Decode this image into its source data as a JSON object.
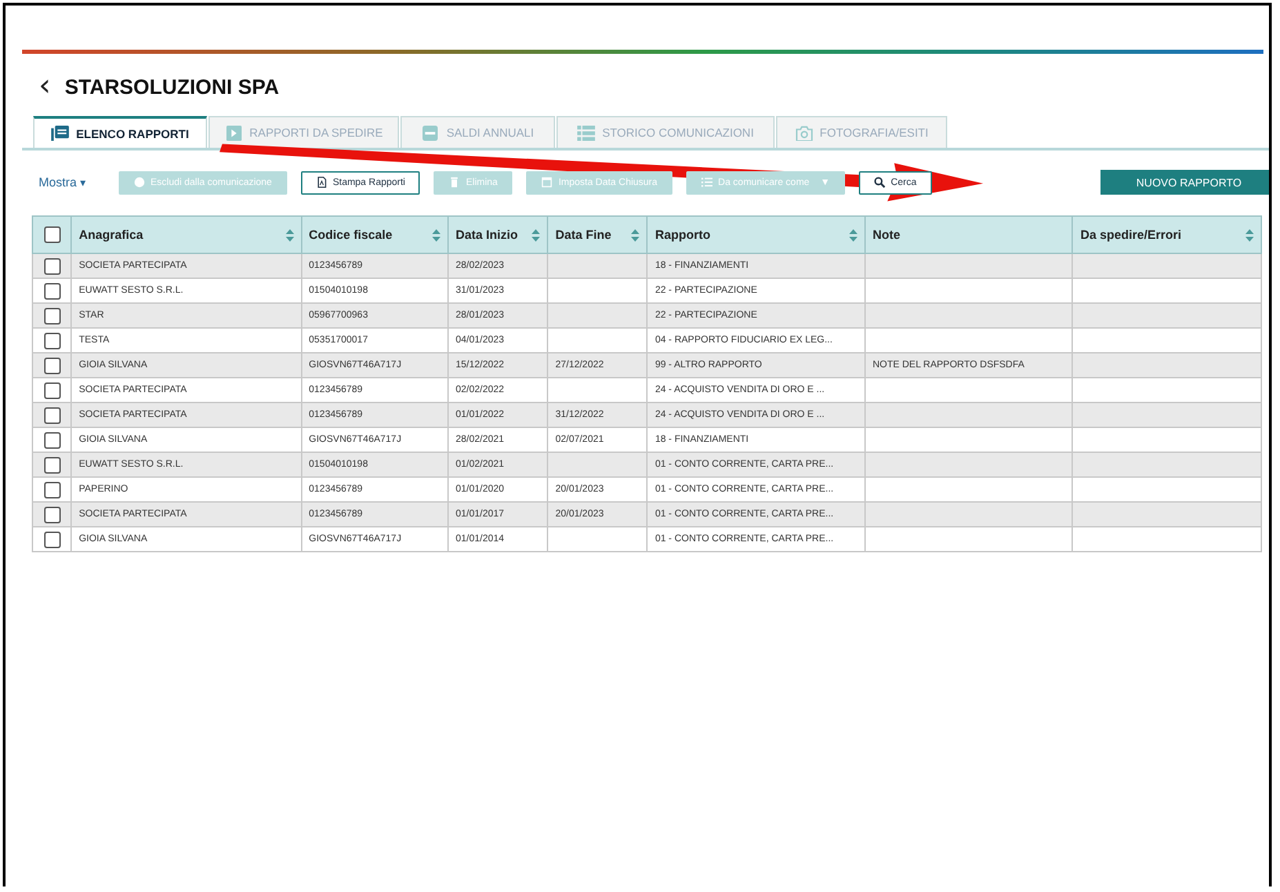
{
  "header": {
    "back": "‹",
    "title": "STARSOLUZIONI SPA"
  },
  "tabs": [
    {
      "label": "ELENCO RAPPORTI",
      "kind": "list",
      "selected": true
    },
    {
      "label": "RAPPORTI DA SPEDIRE",
      "kind": "send",
      "selected": false
    },
    {
      "label": "SALDI ANNUALI",
      "kind": "calendar",
      "selected": false
    },
    {
      "label": "STORICO COMUNICAZIONI",
      "kind": "rows",
      "selected": false
    },
    {
      "label": "FOTOGRAFIA/ESITI",
      "kind": "camera",
      "selected": false
    }
  ],
  "toolbar": {
    "show_menu": "Mostra",
    "show_menu_caret": "▾",
    "buttons": [
      {
        "label": "Escludi dalla comunicazione",
        "kind": "minus",
        "disabled": true
      },
      {
        "label": "Stampa Rapporti",
        "kind": "doc",
        "disabled": false
      },
      {
        "label": "Elimina",
        "kind": "trash",
        "disabled": true
      },
      {
        "label": "Imposta Data Chiusura",
        "kind": "calendar",
        "disabled": true
      },
      {
        "label": "Da comunicare come",
        "kind": "list",
        "disabled": true,
        "dropdown_caret": "▼"
      },
      {
        "label": "Cerca",
        "kind": "search",
        "disabled": false
      }
    ],
    "primary_button": "NUOVO RAPPORTO"
  },
  "table": {
    "select_all_checked": false,
    "columns": [
      {
        "label": "Anagrafica",
        "sortable": true
      },
      {
        "label": "Codice fiscale",
        "sortable": true
      },
      {
        "label": "Data Inizio",
        "sortable": true
      },
      {
        "label": "Data Fine",
        "sortable": true
      },
      {
        "label": "Rapporto",
        "sortable": true
      },
      {
        "label": "Note",
        "sortable": false
      },
      {
        "label": "Da spedire/Errori",
        "sortable": true
      }
    ],
    "rows": [
      {
        "checked": false,
        "cells": [
          "SOCIETA PARTECIPATA",
          "0123456789",
          "28/02/2023",
          "",
          "18 - FINANZIAMENTI",
          "",
          ""
        ]
      },
      {
        "checked": false,
        "cells": [
          "EUWATT SESTO S.R.L.",
          "01504010198",
          "31/01/2023",
          "",
          "22 - PARTECIPAZIONE",
          "",
          ""
        ]
      },
      {
        "checked": false,
        "cells": [
          "STAR",
          "05967700963",
          "28/01/2023",
          "",
          "22 - PARTECIPAZIONE",
          "",
          ""
        ]
      },
      {
        "checked": false,
        "cells": [
          "TESTA",
          "05351700017",
          "04/01/2023",
          "",
          "04 - RAPPORTO FIDUCIARIO EX LEG...",
          "",
          ""
        ]
      },
      {
        "checked": false,
        "cells": [
          "GIOIA SILVANA",
          "GIOSVN67T46A717J",
          "15/12/2022",
          "27/12/2022",
          "99 - ALTRO RAPPORTO",
          "NOTE DEL RAPPORTO DSFSDFA",
          ""
        ]
      },
      {
        "checked": false,
        "cells": [
          "SOCIETA PARTECIPATA",
          "0123456789",
          "02/02/2022",
          "",
          "24 - ACQUISTO VENDITA DI ORO E ...",
          "",
          ""
        ]
      },
      {
        "checked": false,
        "cells": [
          "SOCIETA PARTECIPATA",
          "0123456789",
          "01/01/2022",
          "31/12/2022",
          "24 - ACQUISTO VENDITA DI ORO E ...",
          "",
          ""
        ]
      },
      {
        "checked": false,
        "cells": [
          "GIOIA SILVANA",
          "GIOSVN67T46A717J",
          "28/02/2021",
          "02/07/2021",
          "18 - FINANZIAMENTI",
          "",
          ""
        ]
      },
      {
        "checked": false,
        "cells": [
          "EUWATT SESTO S.R.L.",
          "01504010198",
          "01/02/2021",
          "",
          "01 - CONTO CORRENTE, CARTA PRE...",
          "",
          ""
        ]
      },
      {
        "checked": false,
        "cells": [
          "PAPERINO",
          "0123456789",
          "01/01/2020",
          "20/01/2023",
          "01 - CONTO CORRENTE, CARTA PRE...",
          "",
          ""
        ]
      },
      {
        "checked": false,
        "cells": [
          "SOCIETA PARTECIPATA",
          "0123456789",
          "01/01/2017",
          "20/01/2023",
          "01 - CONTO CORRENTE, CARTA PRE...",
          "",
          ""
        ]
      },
      {
        "checked": false,
        "cells": [
          "GIOIA SILVANA",
          "GIOSVN67T46A717J",
          "01/01/2014",
          "",
          "01 - CONTO CORRENTE, CARTA PRE...",
          "",
          ""
        ]
      }
    ]
  }
}
